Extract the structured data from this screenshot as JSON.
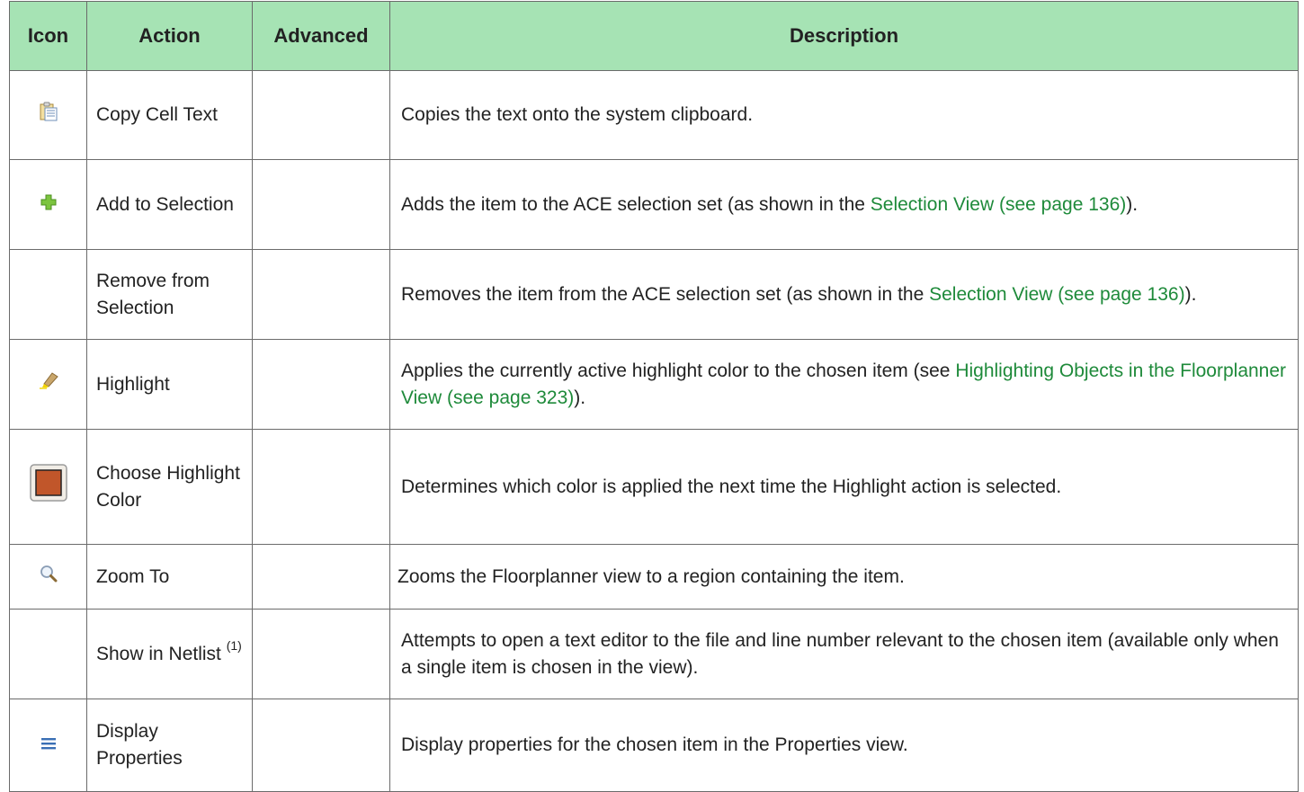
{
  "headers": {
    "icon": "Icon",
    "action": "Action",
    "advanced": "Advanced",
    "description": "Description"
  },
  "rows": [
    {
      "icon": "clipboard-icon",
      "action": "Copy Cell Text",
      "advanced": "",
      "description_parts": [
        "Copies the text onto the system clipboard."
      ]
    },
    {
      "icon": "green-plus-icon",
      "action": "Add to Selection",
      "advanced": "",
      "description_parts": [
        "Adds the item to the ACE selection set (as shown in the ",
        "Selection View (see page 136)",
        ")."
      ]
    },
    {
      "icon": "",
      "action": "Remove from Selection",
      "advanced": "",
      "description_parts": [
        "Removes the item from the ACE selection set (as shown in the ",
        "Selection View (see page 136)",
        ")."
      ]
    },
    {
      "icon": "highlighter-icon",
      "action": "Highlight",
      "advanced": "",
      "description_parts": [
        "Applies the currently active highlight color to the chosen item (see ",
        "Highlighting Objects in the Floorplanner View (see page 323)",
        ")."
      ]
    },
    {
      "icon": "color-swatch-icon",
      "action": "Choose Highlight Color",
      "advanced": "",
      "description_parts": [
        "Determines which color is applied the next time the Highlight action is selected."
      ]
    },
    {
      "icon": "magnifier-icon",
      "action": "Zoom To",
      "advanced": "",
      "description_parts": [
        "Zooms the Floorplanner view to a region containing the item."
      ]
    },
    {
      "icon": "",
      "action": "Show in Netlist",
      "action_sup": "(1)",
      "advanced": "",
      "description_parts": [
        "Attempts to open a text editor to the file and line number relevant to the chosen item (available only when a single item is chosen in the view)."
      ]
    },
    {
      "icon": "list-lines-icon",
      "action": "Display Properties",
      "advanced": "",
      "description_parts": [
        "Display properties for the chosen item in the Properties view."
      ]
    }
  ],
  "colors": {
    "header_bg": "#a6e3b4",
    "link": "#1e8a3a",
    "swatch": "#c1562a"
  }
}
